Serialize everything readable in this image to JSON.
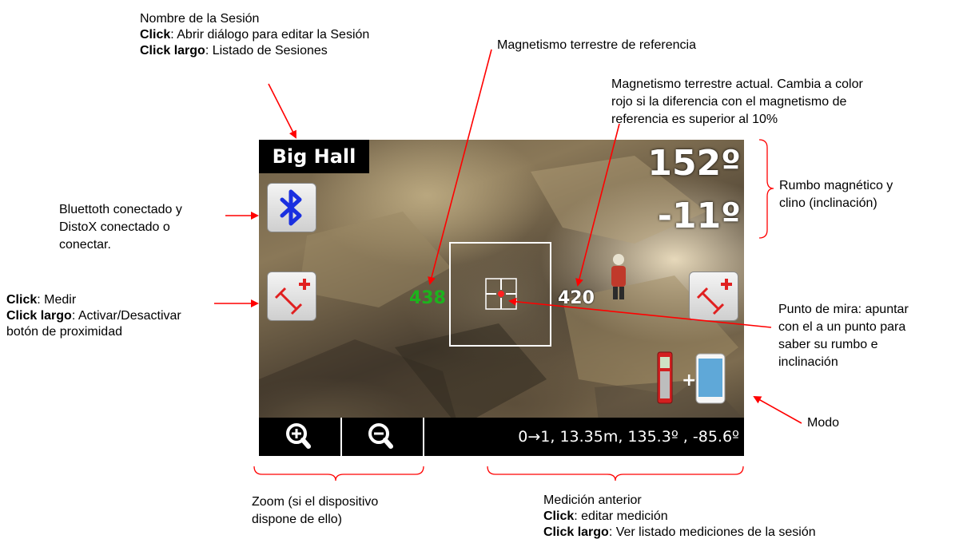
{
  "annotations": {
    "session": {
      "title": "Nombre de la Sesión",
      "click_label": "Click",
      "click_text": ": Abrir diálogo para editar la Sesión",
      "longclick_label": "Click largo",
      "longclick_text": ": Listado de Sesiones"
    },
    "ref_magnetism": "Magnetismo terrestre de referencia",
    "current_magnetism": {
      "line1": "Magnetismo terrestre actual. Cambia a color",
      "line2": "rojo si la diferencia con el magnetismo de",
      "line3": "referencia es superior al 10%"
    },
    "heading": {
      "line1": "Rumbo magnético y",
      "line2": "clino (inclinación)"
    },
    "bluetooth": {
      "line1": "Bluettoth conectado y",
      "line2": "DistoX conectado o",
      "line3": "conectar."
    },
    "measure": {
      "click_label": "Click",
      "click_text": ": Medir",
      "longclick_label": "Click largo",
      "longclick_text": ": Activar/Desactivar",
      "line3": "botón de proximidad"
    },
    "crosshair": {
      "line1": "Punto de mira: apuntar",
      "line2": "con el a un punto para",
      "line3": "saber su rumbo e",
      "line4": "inclinación"
    },
    "mode": "Modo",
    "zoom": {
      "line1": "Zoom (si el dispositivo",
      "line2": "dispone de ello)"
    },
    "previous": {
      "title": "Medición  anterior",
      "click_label": "Click",
      "click_text": ": editar medición",
      "longclick_label": "Click largo",
      "longclick_text": ": Ver listado mediciones de la sesión"
    }
  },
  "screen": {
    "session_name": "Big Hall",
    "azimuth": "152º",
    "clino": "-11º",
    "ref_magnetism_value": "438",
    "current_magnetism_value": "420",
    "last_measurement": "0→1, 13.35m, 135.3º , -85.6º",
    "colors": {
      "ref_magnetism": "#1db31d",
      "current_magnetism": "#ffffff",
      "arrow": "#ff0000",
      "bluetooth": "#1a2fe0"
    },
    "icons": [
      "bluetooth-icon",
      "measure-left-icon",
      "measure-right-icon",
      "mode-icon",
      "zoom-in-icon",
      "zoom-out-icon"
    ]
  }
}
